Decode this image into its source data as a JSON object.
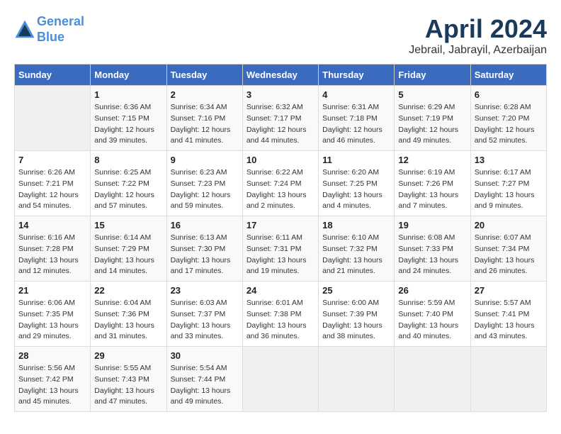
{
  "header": {
    "logo_line1": "General",
    "logo_line2": "Blue",
    "month": "April 2024",
    "location": "Jebrail, Jabrayil, Azerbaijan"
  },
  "days_of_week": [
    "Sunday",
    "Monday",
    "Tuesday",
    "Wednesday",
    "Thursday",
    "Friday",
    "Saturday"
  ],
  "weeks": [
    [
      {
        "day": "",
        "sunrise": "",
        "sunset": "",
        "daylight": "",
        "empty": true
      },
      {
        "day": "1",
        "sunrise": "Sunrise: 6:36 AM",
        "sunset": "Sunset: 7:15 PM",
        "daylight": "Daylight: 12 hours and 39 minutes."
      },
      {
        "day": "2",
        "sunrise": "Sunrise: 6:34 AM",
        "sunset": "Sunset: 7:16 PM",
        "daylight": "Daylight: 12 hours and 41 minutes."
      },
      {
        "day": "3",
        "sunrise": "Sunrise: 6:32 AM",
        "sunset": "Sunset: 7:17 PM",
        "daylight": "Daylight: 12 hours and 44 minutes."
      },
      {
        "day": "4",
        "sunrise": "Sunrise: 6:31 AM",
        "sunset": "Sunset: 7:18 PM",
        "daylight": "Daylight: 12 hours and 46 minutes."
      },
      {
        "day": "5",
        "sunrise": "Sunrise: 6:29 AM",
        "sunset": "Sunset: 7:19 PM",
        "daylight": "Daylight: 12 hours and 49 minutes."
      },
      {
        "day": "6",
        "sunrise": "Sunrise: 6:28 AM",
        "sunset": "Sunset: 7:20 PM",
        "daylight": "Daylight: 12 hours and 52 minutes."
      }
    ],
    [
      {
        "day": "7",
        "sunrise": "Sunrise: 6:26 AM",
        "sunset": "Sunset: 7:21 PM",
        "daylight": "Daylight: 12 hours and 54 minutes."
      },
      {
        "day": "8",
        "sunrise": "Sunrise: 6:25 AM",
        "sunset": "Sunset: 7:22 PM",
        "daylight": "Daylight: 12 hours and 57 minutes."
      },
      {
        "day": "9",
        "sunrise": "Sunrise: 6:23 AM",
        "sunset": "Sunset: 7:23 PM",
        "daylight": "Daylight: 12 hours and 59 minutes."
      },
      {
        "day": "10",
        "sunrise": "Sunrise: 6:22 AM",
        "sunset": "Sunset: 7:24 PM",
        "daylight": "Daylight: 13 hours and 2 minutes."
      },
      {
        "day": "11",
        "sunrise": "Sunrise: 6:20 AM",
        "sunset": "Sunset: 7:25 PM",
        "daylight": "Daylight: 13 hours and 4 minutes."
      },
      {
        "day": "12",
        "sunrise": "Sunrise: 6:19 AM",
        "sunset": "Sunset: 7:26 PM",
        "daylight": "Daylight: 13 hours and 7 minutes."
      },
      {
        "day": "13",
        "sunrise": "Sunrise: 6:17 AM",
        "sunset": "Sunset: 7:27 PM",
        "daylight": "Daylight: 13 hours and 9 minutes."
      }
    ],
    [
      {
        "day": "14",
        "sunrise": "Sunrise: 6:16 AM",
        "sunset": "Sunset: 7:28 PM",
        "daylight": "Daylight: 13 hours and 12 minutes."
      },
      {
        "day": "15",
        "sunrise": "Sunrise: 6:14 AM",
        "sunset": "Sunset: 7:29 PM",
        "daylight": "Daylight: 13 hours and 14 minutes."
      },
      {
        "day": "16",
        "sunrise": "Sunrise: 6:13 AM",
        "sunset": "Sunset: 7:30 PM",
        "daylight": "Daylight: 13 hours and 17 minutes."
      },
      {
        "day": "17",
        "sunrise": "Sunrise: 6:11 AM",
        "sunset": "Sunset: 7:31 PM",
        "daylight": "Daylight: 13 hours and 19 minutes."
      },
      {
        "day": "18",
        "sunrise": "Sunrise: 6:10 AM",
        "sunset": "Sunset: 7:32 PM",
        "daylight": "Daylight: 13 hours and 21 minutes."
      },
      {
        "day": "19",
        "sunrise": "Sunrise: 6:08 AM",
        "sunset": "Sunset: 7:33 PM",
        "daylight": "Daylight: 13 hours and 24 minutes."
      },
      {
        "day": "20",
        "sunrise": "Sunrise: 6:07 AM",
        "sunset": "Sunset: 7:34 PM",
        "daylight": "Daylight: 13 hours and 26 minutes."
      }
    ],
    [
      {
        "day": "21",
        "sunrise": "Sunrise: 6:06 AM",
        "sunset": "Sunset: 7:35 PM",
        "daylight": "Daylight: 13 hours and 29 minutes."
      },
      {
        "day": "22",
        "sunrise": "Sunrise: 6:04 AM",
        "sunset": "Sunset: 7:36 PM",
        "daylight": "Daylight: 13 hours and 31 minutes."
      },
      {
        "day": "23",
        "sunrise": "Sunrise: 6:03 AM",
        "sunset": "Sunset: 7:37 PM",
        "daylight": "Daylight: 13 hours and 33 minutes."
      },
      {
        "day": "24",
        "sunrise": "Sunrise: 6:01 AM",
        "sunset": "Sunset: 7:38 PM",
        "daylight": "Daylight: 13 hours and 36 minutes."
      },
      {
        "day": "25",
        "sunrise": "Sunrise: 6:00 AM",
        "sunset": "Sunset: 7:39 PM",
        "daylight": "Daylight: 13 hours and 38 minutes."
      },
      {
        "day": "26",
        "sunrise": "Sunrise: 5:59 AM",
        "sunset": "Sunset: 7:40 PM",
        "daylight": "Daylight: 13 hours and 40 minutes."
      },
      {
        "day": "27",
        "sunrise": "Sunrise: 5:57 AM",
        "sunset": "Sunset: 7:41 PM",
        "daylight": "Daylight: 13 hours and 43 minutes."
      }
    ],
    [
      {
        "day": "28",
        "sunrise": "Sunrise: 5:56 AM",
        "sunset": "Sunset: 7:42 PM",
        "daylight": "Daylight: 13 hours and 45 minutes."
      },
      {
        "day": "29",
        "sunrise": "Sunrise: 5:55 AM",
        "sunset": "Sunset: 7:43 PM",
        "daylight": "Daylight: 13 hours and 47 minutes."
      },
      {
        "day": "30",
        "sunrise": "Sunrise: 5:54 AM",
        "sunset": "Sunset: 7:44 PM",
        "daylight": "Daylight: 13 hours and 49 minutes."
      },
      {
        "day": "",
        "sunrise": "",
        "sunset": "",
        "daylight": "",
        "empty": true
      },
      {
        "day": "",
        "sunrise": "",
        "sunset": "",
        "daylight": "",
        "empty": true
      },
      {
        "day": "",
        "sunrise": "",
        "sunset": "",
        "daylight": "",
        "empty": true
      },
      {
        "day": "",
        "sunrise": "",
        "sunset": "",
        "daylight": "",
        "empty": true
      }
    ]
  ]
}
